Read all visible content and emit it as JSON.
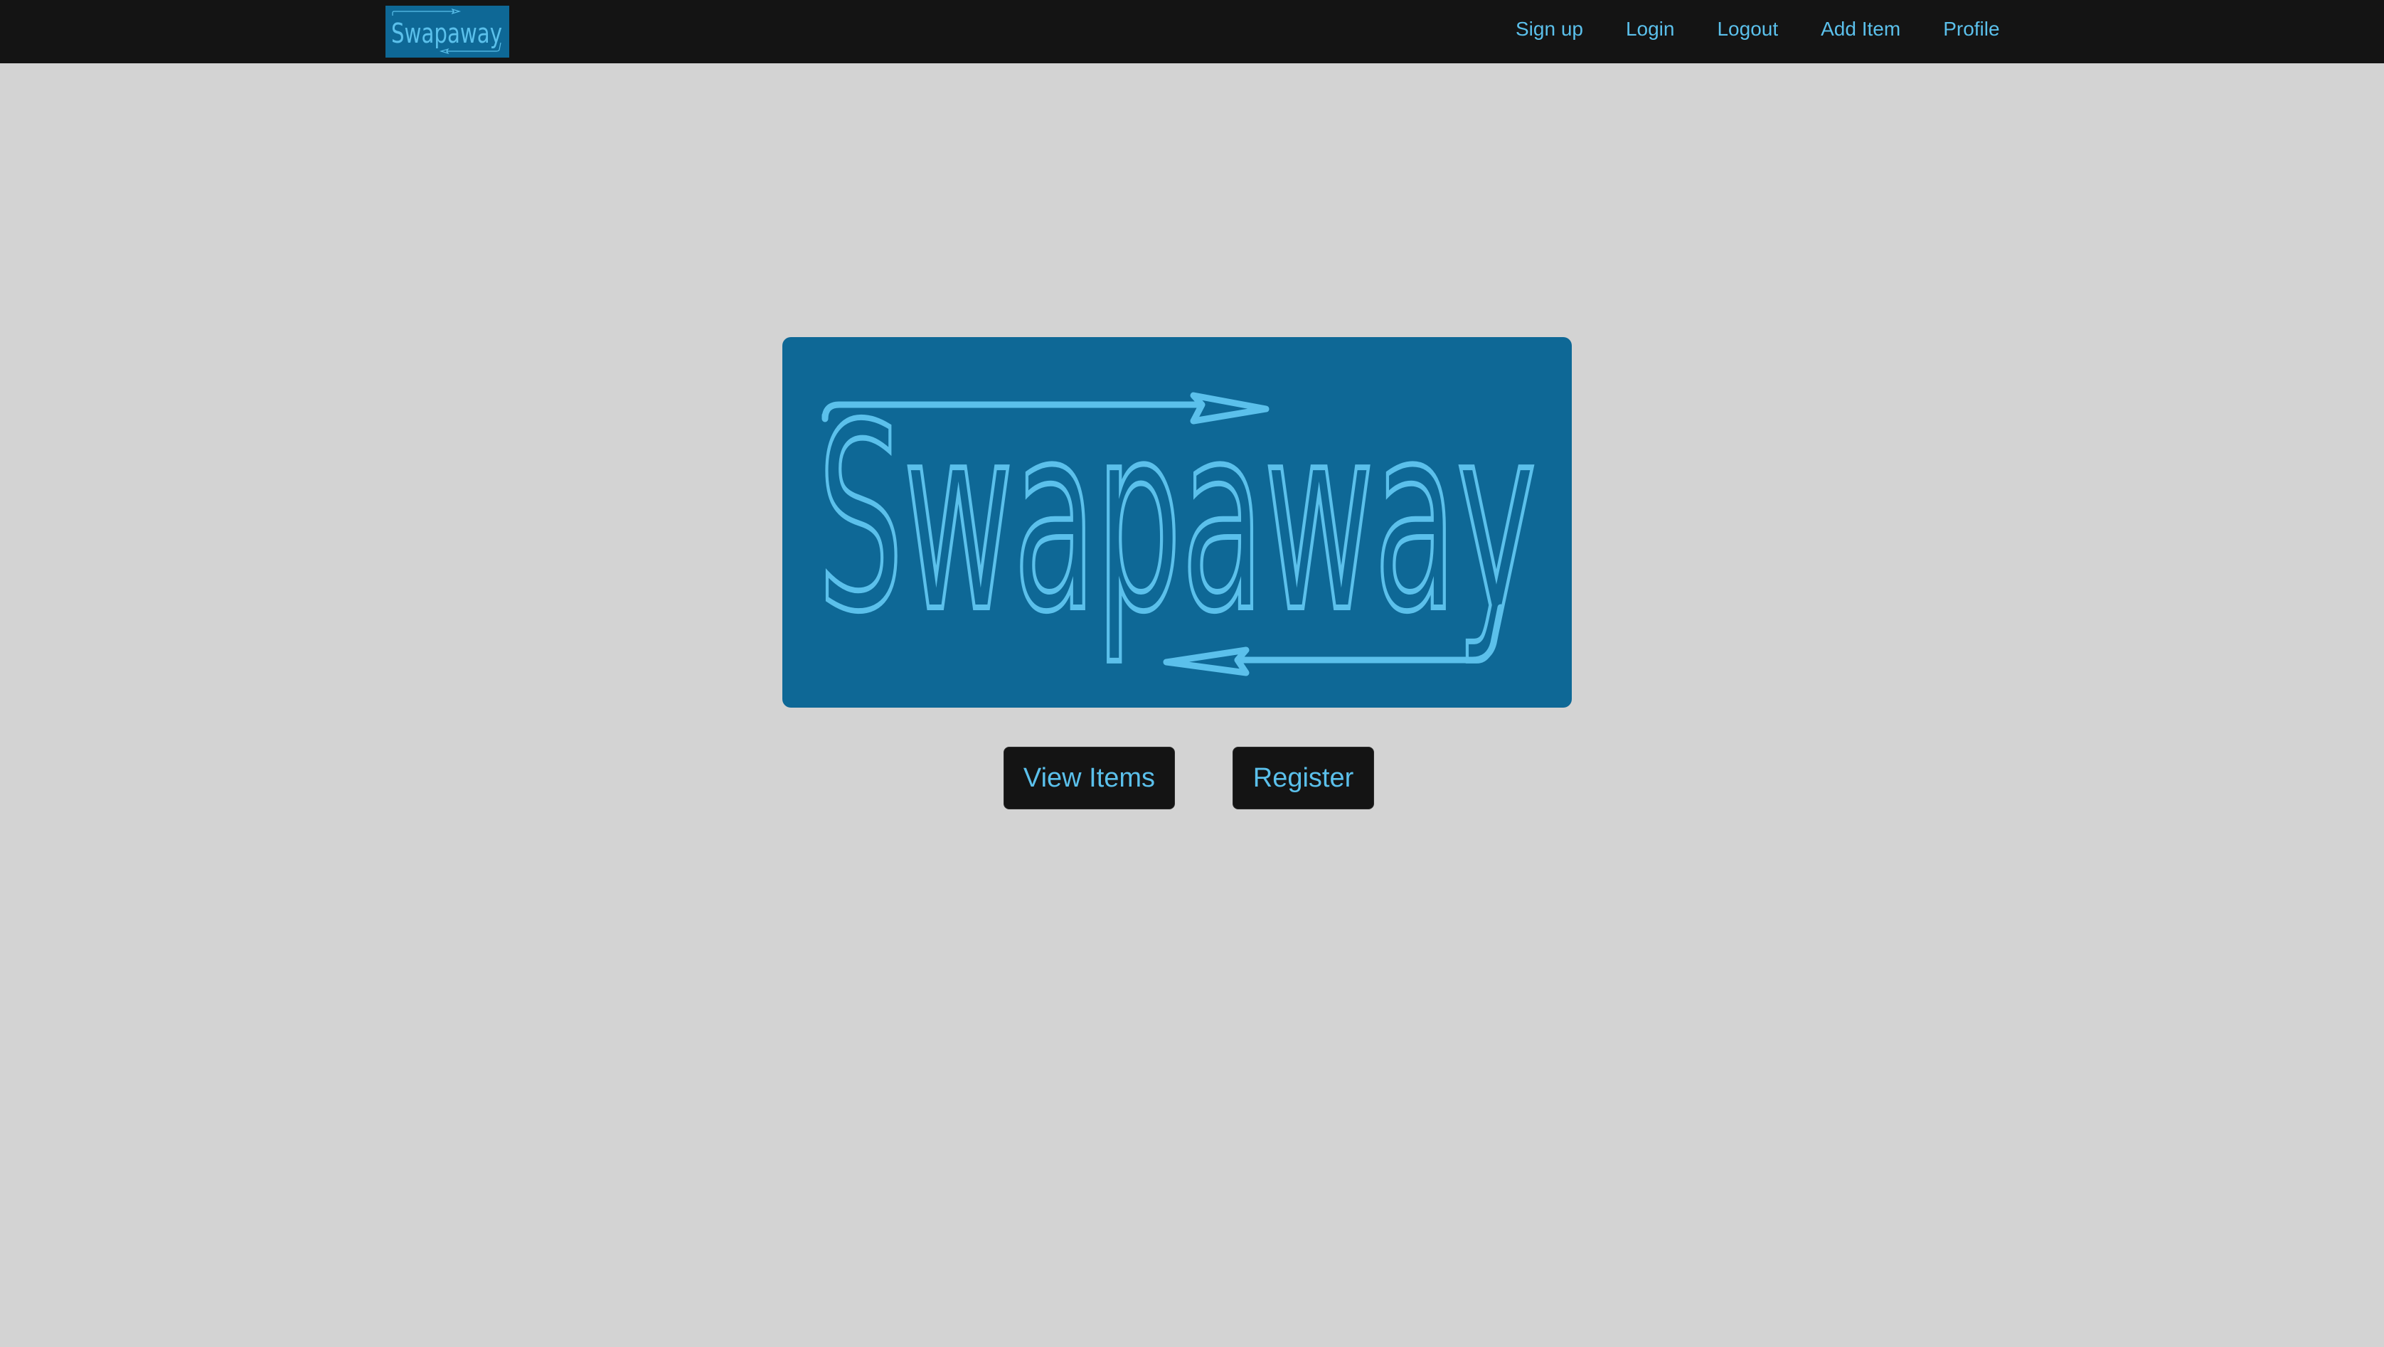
{
  "brand": {
    "name": "Swapaway",
    "logo_bg": "#0e6896",
    "logo_fg": "#5bc0eb"
  },
  "nav": {
    "links": [
      {
        "label": "Sign up",
        "icon": null
      },
      {
        "label": "Login",
        "icon": null
      },
      {
        "label": "Logout",
        "icon": null
      },
      {
        "label": "Add Item",
        "icon": null
      },
      {
        "label": "Profile",
        "icon": null
      }
    ]
  },
  "hero": {
    "logo_text": "Swapaway"
  },
  "actions": {
    "view_items_label": "View Items",
    "register_label": "Register"
  },
  "colors": {
    "navbar_bg": "#141414",
    "page_bg": "#d3d3d3",
    "accent": "#5bc0eb",
    "button_bg": "#141414"
  }
}
